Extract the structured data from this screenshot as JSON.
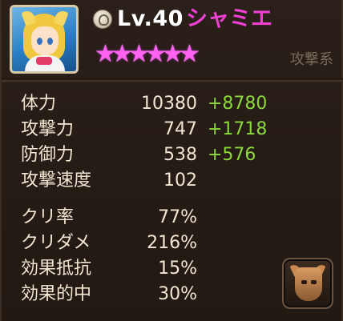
{
  "monster": {
    "level": "Lv.40",
    "name": "シャミエ",
    "stars": 6,
    "element_type": "攻撃系",
    "portrait_icon": "monster-portrait",
    "rune_icon": "rune-icon"
  },
  "stats": [
    {
      "label": "体力",
      "base": "10380",
      "bonus": "+8780"
    },
    {
      "label": "攻撃力",
      "base": "747",
      "bonus": "+1718"
    },
    {
      "label": "防御力",
      "base": "538",
      "bonus": "+576"
    },
    {
      "label": "攻撃速度",
      "base": "102",
      "bonus": ""
    }
  ],
  "sub_stats": [
    {
      "label": "クリ率",
      "base": "77%"
    },
    {
      "label": "クリダメ",
      "base": "216%"
    },
    {
      "label": "効果抵抗",
      "base": "15%"
    },
    {
      "label": "効果的中",
      "base": "30%"
    }
  ],
  "skill_button_icon": "mask-icon",
  "colors": {
    "name": "#f03fd2",
    "bonus": "#8cd93c",
    "text": "#f2e6d2",
    "background": "#221913",
    "stars": "#ff62f0"
  }
}
